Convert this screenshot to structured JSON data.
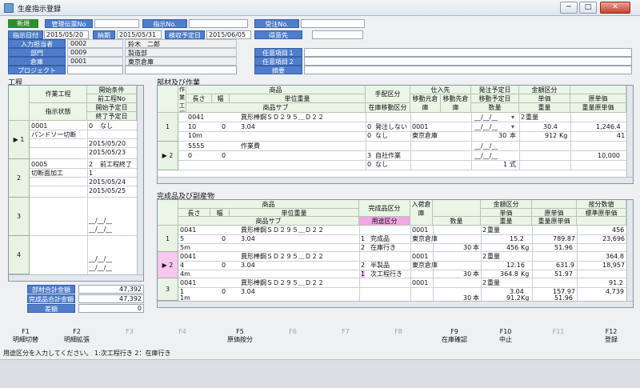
{
  "window": {
    "title": "生産指示登録",
    "minimize": "─",
    "maximize": "□",
    "close": "✕"
  },
  "header": {
    "new_badge": "新規",
    "mgmt_voucher_label": "管理伝票No",
    "order_no_label": "指示No.",
    "accept_no_label": "受注No.",
    "order_date_label": "指示日付",
    "order_date": "2015/05/20",
    "delivery_label": "納期",
    "delivery": "2015/05/31",
    "inspect_label": "検収予定日",
    "inspect": "2015/06/05",
    "customer_label": "得意先",
    "entry_user_label": "入力担当者",
    "entry_user_code": "0002",
    "entry_user_name": "鈴木　二郎",
    "dept_label": "部門",
    "dept_code": "0009",
    "dept_name": "製造部",
    "warehouse_label": "倉庫",
    "warehouse_code": "0001",
    "warehouse_name": "東京倉庫",
    "project_label": "プロジェクト",
    "opt1_label": "任意項目１",
    "opt2_label": "任意項目２",
    "remarks_label": "摘要"
  },
  "process": {
    "section": "工程",
    "headers": {
      "process": "作業工程",
      "status": "指示状態",
      "start_cond": "開始条件",
      "prev_no": "前工程No",
      "start_date": "開始予定日",
      "end_date": "終了予定日"
    },
    "rows": [
      {
        "no": "1",
        "code": "0001",
        "name": "バンドソー切断",
        "cond_no": "0",
        "cond": "なし",
        "prev": "",
        "start": "2015/05/20",
        "end": "2015/05/23"
      },
      {
        "no": "2",
        "code": "0005",
        "name": "切断面加工",
        "cond_no": "2",
        "cond": "前工程終了",
        "prev": "1",
        "start": "2015/05/24",
        "end": "2015/05/25"
      },
      {
        "no": "3",
        "code": "",
        "name": "",
        "cond_no": "",
        "cond": "",
        "prev": "",
        "start": "__/__/__",
        "end": "__/__/__"
      },
      {
        "no": "4",
        "code": "",
        "name": "",
        "cond_no": "",
        "cond": "",
        "prev": "",
        "start": "__/__/__",
        "end": "__/__/__"
      }
    ],
    "totals": {
      "material_label": "部材合計金額",
      "material": "47,392",
      "product_label": "完成品合計金額",
      "product": "47,392",
      "diff_label": "差額",
      "diff": "0"
    }
  },
  "materials": {
    "section": "部材及び作業",
    "headers": {
      "col0": "作業工程",
      "item": "商品",
      "len": "長さ",
      "width": "幅",
      "unit_weight": "単位重量",
      "item_sub": "商品サブ",
      "arrange": "手配区分",
      "stock_move": "在庫移動区分",
      "supplier": "仕入先",
      "move_src": "移動元倉庫",
      "move_dst": "移動先倉庫",
      "order_date": "発注予定日",
      "move_date": "移動予定日",
      "qty": "数量",
      "amount": "金額区分",
      "unit_price": "単価",
      "weight": "重量",
      "cost": "原単価",
      "weight_cost": "重量原単価"
    },
    "rows": [
      {
        "no": "1",
        "code": "0041",
        "name": "異形棒鋼ＳＤ２９５＿Ｄ２２",
        "len": "10",
        "width": "0",
        "uw": "3.04",
        "sub": "10m",
        "arr_no": "0",
        "arr": "発注しない",
        "mv_no": "0",
        "mv": "なし",
        "sup": "0001",
        "src": "東京倉庫",
        "date1": "__/__/__",
        "date2": "__/__/__",
        "qty": "30",
        "unit": "本",
        "amt_no": "2",
        "amt": "重量",
        "price": "30.4",
        "weight": "912",
        "wunit": "Kg",
        "cost": "1,246.4",
        "wcost": "41"
      },
      {
        "no": "2",
        "code": "5555",
        "name": "作業費",
        "len": "0",
        "width": "0",
        "uw": "",
        "sub": "",
        "arr_no": "3",
        "arr": "自社作業",
        "mv_no": "0",
        "mv": "なし",
        "sup": "",
        "src": "",
        "date1": "__/__/__",
        "date2": "__/__/__",
        "qty": "1",
        "unit": "式",
        "amt_no": "",
        "amt": "",
        "price": "",
        "weight": "",
        "wunit": "",
        "cost": "10,000",
        "wcost": ""
      }
    ]
  },
  "products": {
    "section": "完成品及び副産物",
    "headers": {
      "item": "商品",
      "len": "長さ",
      "width": "幅",
      "unit_weight": "単位重量",
      "item_sub": "商品サブ",
      "done_type": "完成品区分",
      "use_type": "用途区分",
      "wh": "入荷倉庫",
      "qty": "数量",
      "amount": "金額区分",
      "unit_price": "単価",
      "weight": "重量",
      "cost": "原単価",
      "weight_cost": "重量原単価",
      "alloc": "按分数値",
      "std_price": "標準原単価"
    },
    "rows": [
      {
        "no": "1",
        "code": "0041",
        "name": "異形棒鋼ＳＤ２９５＿Ｄ２２",
        "len": "5",
        "width": "0",
        "uw": "3.04",
        "sub": "5m",
        "t1n": "1",
        "t1": "完成品",
        "t2n": "2",
        "t2": "在庫行き",
        "wh": "0001",
        "whn": "東京倉庫",
        "qty": "30",
        "unit": "本",
        "amt_no": "2",
        "amt": "重量",
        "price": "15.2",
        "weight": "456",
        "wunit": "Kg",
        "cost": "789.87",
        "wcost": "51.96",
        "alloc": "456",
        "std": "23,696"
      },
      {
        "no": "2",
        "code": "0041",
        "name": "異形棒鋼ＳＤ２９５＿Ｄ２２",
        "len": "4",
        "width": "0",
        "uw": "3.04",
        "sub": "4m",
        "t1n": "2",
        "t1": "半製品",
        "t2n": "1",
        "t2": "次工程行き",
        "wh": "0001",
        "whn": "東京倉庫",
        "qty": "30",
        "unit": "本",
        "amt_no": "2",
        "amt": "重量",
        "price": "12.16",
        "weight": "364.8",
        "wunit": "Kg",
        "cost": "631.9",
        "wcost": "51.97",
        "alloc": "364.8",
        "std": "18,957"
      },
      {
        "no": "3",
        "code": "0041",
        "name": "異形棒鋼ＳＤ２９５＿Ｄ２２",
        "len": "1",
        "width": "0",
        "uw": "3.04",
        "sub": "1m",
        "t1n": "2",
        "t1": "副産物",
        "t2n": "2",
        "t2": "在庫行き",
        "wh": "0001",
        "whn": "東京倉庫",
        "qty": "30",
        "unit": "本",
        "amt_no": "2",
        "amt": "重量",
        "price": "3.04",
        "weight": "91.2",
        "wunit": "Kg",
        "cost": "157.97",
        "wcost": "51.96",
        "alloc": "91.2",
        "std": "4,739"
      }
    ]
  },
  "fkeys": [
    {
      "key": "F1",
      "label": "明細切替",
      "enabled": true
    },
    {
      "key": "F2",
      "label": "明細拡張",
      "enabled": true
    },
    {
      "key": "F3",
      "label": "",
      "enabled": false
    },
    {
      "key": "F4",
      "label": "",
      "enabled": false
    },
    {
      "key": "F5",
      "label": "原価按分",
      "enabled": true
    },
    {
      "key": "F6",
      "label": "",
      "enabled": false
    },
    {
      "key": "F7",
      "label": "",
      "enabled": false
    },
    {
      "key": "F8",
      "label": "",
      "enabled": false
    },
    {
      "key": "F9",
      "label": "在庫確認",
      "enabled": true
    },
    {
      "key": "F10",
      "label": "中止",
      "enabled": true
    },
    {
      "key": "F11",
      "label": "",
      "enabled": false
    },
    {
      "key": "F12",
      "label": "登録",
      "enabled": true
    }
  ],
  "status_text": "用途区分を入力してください。 1:次工程行き 2：在庫行き"
}
